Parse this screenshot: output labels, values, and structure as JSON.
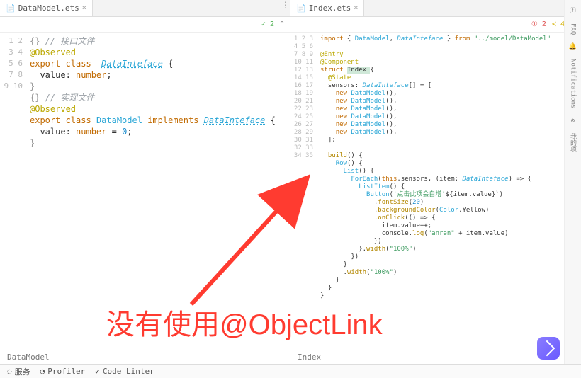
{
  "tabs": {
    "left": "DataModel.ets",
    "right": "Index.ets"
  },
  "hints": {
    "left_green": "✓ 2",
    "left_menu": "^",
    "right_red": "① 2",
    "right_yellow": "≺ 4",
    "right_menu": "^"
  },
  "left": {
    "lines": [
      {
        "n": 1,
        "seg": [
          [
            "op",
            "{} "
          ],
          [
            "com",
            "// 接口文件"
          ]
        ]
      },
      {
        "n": 2,
        "seg": [
          [
            "dec",
            "@Observed"
          ]
        ]
      },
      {
        "n": 3,
        "seg": [
          [
            "kw",
            "export class"
          ],
          [
            "",
            "  "
          ],
          [
            "type",
            "DataInteface"
          ],
          [
            "",
            " {"
          ]
        ]
      },
      {
        "n": 4,
        "seg": [
          [
            "",
            "  value: "
          ],
          [
            "kw",
            "number"
          ],
          [
            "",
            ";"
          ]
        ]
      },
      {
        "n": 5,
        "seg": [
          [
            "op",
            "}"
          ]
        ]
      },
      {
        "n": 6,
        "seg": [
          [
            "op",
            "{} "
          ],
          [
            "com",
            "// 实现文件"
          ]
        ]
      },
      {
        "n": 7,
        "seg": [
          [
            "dec",
            "@Observed"
          ]
        ]
      },
      {
        "n": 8,
        "seg": [
          [
            "kw",
            "export class"
          ],
          [
            "",
            " "
          ],
          [
            "cls",
            "DataModel"
          ],
          [
            "",
            " "
          ],
          [
            "kw",
            "implements"
          ],
          [
            "",
            " "
          ],
          [
            "type",
            "DataInteface"
          ],
          [
            "",
            " {"
          ]
        ]
      },
      {
        "n": 9,
        "seg": [
          [
            "",
            "  value: "
          ],
          [
            "kw",
            "number"
          ],
          [
            "",
            " = "
          ],
          [
            "num",
            "0"
          ],
          [
            "",
            ";"
          ]
        ]
      },
      {
        "n": 10,
        "seg": [
          [
            "op",
            "}"
          ]
        ]
      }
    ]
  },
  "right": {
    "lines": [
      {
        "n": 1,
        "seg": [
          [
            "kw",
            "import"
          ],
          [
            "",
            " { "
          ],
          [
            "cls",
            "DataModel"
          ],
          [
            "",
            ", "
          ],
          [
            "type2",
            "DataInteface"
          ],
          [
            "",
            " } "
          ],
          [
            "kw",
            "from"
          ],
          [
            "",
            " "
          ],
          [
            "str",
            "\"../model/DataModel\""
          ]
        ]
      },
      {
        "n": 2,
        "seg": [
          [
            "",
            ""
          ]
        ]
      },
      {
        "n": 3,
        "seg": [
          [
            "dec",
            "@Entry"
          ]
        ]
      },
      {
        "n": 4,
        "seg": [
          [
            "dec",
            "@Component"
          ]
        ]
      },
      {
        "n": 5,
        "seg": [
          [
            "kw",
            "struct"
          ],
          [
            "",
            " "
          ],
          [
            "cursor-hl",
            "Index "
          ],
          [
            "",
            "{"
          ]
        ]
      },
      {
        "n": 6,
        "seg": [
          [
            "",
            "  "
          ],
          [
            "dec",
            "@State"
          ]
        ]
      },
      {
        "n": 7,
        "seg": [
          [
            "",
            "  sensors: "
          ],
          [
            "type2",
            "DataInteface"
          ],
          [
            "",
            "[] = ["
          ]
        ]
      },
      {
        "n": 8,
        "seg": [
          [
            "",
            "    "
          ],
          [
            "kw",
            "new"
          ],
          [
            "",
            " "
          ],
          [
            "cls",
            "DataModel"
          ],
          [
            "",
            "(),"
          ]
        ]
      },
      {
        "n": 9,
        "seg": [
          [
            "",
            "    "
          ],
          [
            "kw",
            "new"
          ],
          [
            "",
            " "
          ],
          [
            "cls",
            "DataModel"
          ],
          [
            "",
            "(),"
          ]
        ]
      },
      {
        "n": 10,
        "seg": [
          [
            "",
            "    "
          ],
          [
            "kw",
            "new"
          ],
          [
            "",
            " "
          ],
          [
            "cls",
            "DataModel"
          ],
          [
            "",
            "(),"
          ]
        ]
      },
      {
        "n": 11,
        "seg": [
          [
            "",
            "    "
          ],
          [
            "kw",
            "new"
          ],
          [
            "",
            " "
          ],
          [
            "cls",
            "DataModel"
          ],
          [
            "",
            "(),"
          ]
        ]
      },
      {
        "n": 12,
        "seg": [
          [
            "",
            "    "
          ],
          [
            "kw",
            "new"
          ],
          [
            "",
            " "
          ],
          [
            "cls",
            "DataModel"
          ],
          [
            "",
            "(),"
          ]
        ]
      },
      {
        "n": 13,
        "seg": [
          [
            "",
            "    "
          ],
          [
            "kw",
            "new"
          ],
          [
            "",
            " "
          ],
          [
            "cls",
            "DataModel"
          ],
          [
            "",
            "(),"
          ]
        ]
      },
      {
        "n": 14,
        "seg": [
          [
            "",
            "  ];"
          ]
        ]
      },
      {
        "n": 15,
        "seg": [
          [
            "",
            ""
          ]
        ]
      },
      {
        "n": 16,
        "seg": [
          [
            "",
            "  "
          ],
          [
            "fn",
            "build"
          ],
          [
            "",
            "() {"
          ]
        ]
      },
      {
        "n": 17,
        "seg": [
          [
            "",
            "    "
          ],
          [
            "cls",
            "Row"
          ],
          [
            "",
            "() {"
          ]
        ]
      },
      {
        "n": 18,
        "seg": [
          [
            "",
            "      "
          ],
          [
            "cls",
            "List"
          ],
          [
            "",
            "() {"
          ]
        ]
      },
      {
        "n": 19,
        "seg": [
          [
            "",
            "        "
          ],
          [
            "cls",
            "ForEach"
          ],
          [
            "",
            "("
          ],
          [
            "kw",
            "this"
          ],
          [
            "",
            ".sensors, (item: "
          ],
          [
            "type2",
            "DataInteface"
          ],
          [
            "",
            ") => {"
          ]
        ]
      },
      {
        "n": 20,
        "seg": [
          [
            "",
            "          "
          ],
          [
            "cls",
            "ListItem"
          ],
          [
            "",
            "() {"
          ]
        ]
      },
      {
        "n": 21,
        "seg": [
          [
            "",
            "            "
          ],
          [
            "cls",
            "Button"
          ],
          [
            "",
            "("
          ],
          [
            "str",
            "'点击此项会自增'"
          ],
          [
            "",
            "${item.value}`)"
          ]
        ]
      },
      {
        "n": 22,
        "seg": [
          [
            "",
            "              ."
          ],
          [
            "fn",
            "fontSize"
          ],
          [
            "",
            "("
          ],
          [
            "num",
            "20"
          ],
          [
            "",
            ")"
          ]
        ]
      },
      {
        "n": 23,
        "seg": [
          [
            "",
            "              ."
          ],
          [
            "fn",
            "backgroundColor"
          ],
          [
            "",
            "("
          ],
          [
            "cls",
            "Color"
          ],
          [
            "",
            ".Yellow)"
          ]
        ]
      },
      {
        "n": 24,
        "seg": [
          [
            "",
            "              ."
          ],
          [
            "fn",
            "onClick"
          ],
          [
            "",
            "(() => {"
          ]
        ]
      },
      {
        "n": 25,
        "seg": [
          [
            "",
            "                item.value++;"
          ]
        ]
      },
      {
        "n": 26,
        "seg": [
          [
            "",
            "                console."
          ],
          [
            "fn",
            "log"
          ],
          [
            "",
            "("
          ],
          [
            "str",
            "\"anren\""
          ],
          [
            "",
            " + item.value)"
          ]
        ]
      },
      {
        "n": 27,
        "seg": [
          [
            "",
            "              })"
          ]
        ]
      },
      {
        "n": 28,
        "seg": [
          [
            "",
            "          }."
          ],
          [
            "fn",
            "width"
          ],
          [
            "",
            "("
          ],
          [
            "str",
            "\"100%\""
          ],
          [
            "",
            ")"
          ]
        ]
      },
      {
        "n": 29,
        "seg": [
          [
            "",
            "        })"
          ]
        ]
      },
      {
        "n": 30,
        "seg": [
          [
            "",
            "      }"
          ]
        ]
      },
      {
        "n": 31,
        "seg": [
          [
            "",
            "      ."
          ],
          [
            "fn",
            "width"
          ],
          [
            "",
            "("
          ],
          [
            "str",
            "\"100%\""
          ],
          [
            "",
            ")"
          ]
        ]
      },
      {
        "n": 32,
        "seg": [
          [
            "",
            "    }"
          ]
        ]
      },
      {
        "n": 33,
        "seg": [
          [
            "",
            "  }"
          ]
        ]
      },
      {
        "n": 34,
        "seg": [
          [
            "",
            "}"
          ]
        ]
      },
      {
        "n": 35,
        "seg": [
          [
            "",
            ""
          ]
        ]
      }
    ]
  },
  "breadcrumbs": {
    "left": "DataModel",
    "right": "Index"
  },
  "status": {
    "services": "服务",
    "profiler": "Profiler",
    "linter": "Code Linter"
  },
  "rightbar": {
    "faq": "FAQ",
    "notif": "Notifications",
    "tools": "我的项"
  },
  "annotation": "没有使用@ObjectLink"
}
